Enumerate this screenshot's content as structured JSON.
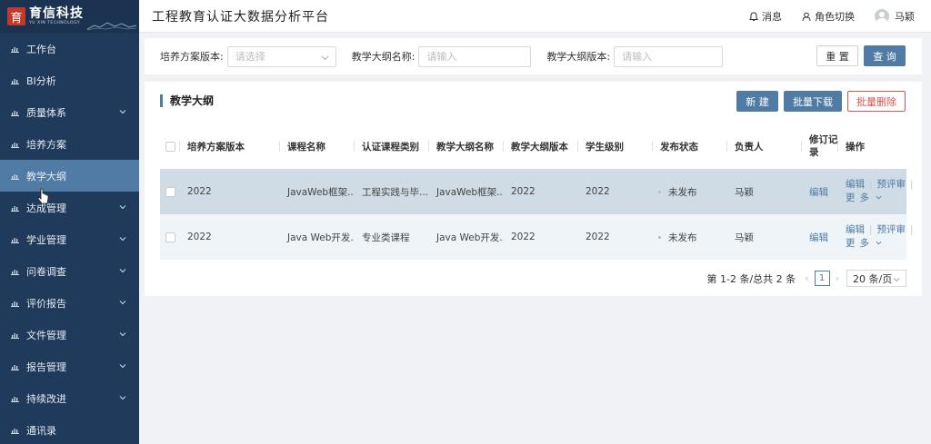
{
  "logo": {
    "mark": "育",
    "name": "育信科技",
    "sub": "YU XIN TECHNOLOGY"
  },
  "header": {
    "title": "工程教育认证大数据分析平台",
    "messages": "消息",
    "role_switch": "角色切换",
    "user": "马颖"
  },
  "sidebar": {
    "items": [
      {
        "label": "工作台",
        "expandable": false
      },
      {
        "label": "BI分析",
        "expandable": false
      },
      {
        "label": "质量体系",
        "expandable": true
      },
      {
        "label": "培养方案",
        "expandable": false
      },
      {
        "label": "教学大纲",
        "expandable": false,
        "active": true
      },
      {
        "label": "达成管理",
        "expandable": true
      },
      {
        "label": "学业管理",
        "expandable": true
      },
      {
        "label": "问卷调查",
        "expandable": true
      },
      {
        "label": "评价报告",
        "expandable": true
      },
      {
        "label": "文件管理",
        "expandable": true
      },
      {
        "label": "报告管理",
        "expandable": true
      },
      {
        "label": "持续改进",
        "expandable": true
      },
      {
        "label": "通讯录",
        "expandable": false
      }
    ]
  },
  "filter": {
    "plan_version_label": "培养方案版本:",
    "plan_version_placeholder": "请选择",
    "syllabus_name_label": "教学大纲名称:",
    "syllabus_name_placeholder": "请输入",
    "syllabus_version_label": "教学大纲版本:",
    "syllabus_version_placeholder": "请输入",
    "reset": "重 置",
    "query": "查 询"
  },
  "main": {
    "title": "教学大纲",
    "btn_new": "新 建",
    "btn_download": "批量下载",
    "btn_delete": "批量删除"
  },
  "table": {
    "headers": [
      "培养方案版本",
      "课程名称",
      "认证课程类别",
      "教学大纲名称",
      "教学大纲版本",
      "学生级别",
      "发布状态",
      "负责人",
      "修订记录",
      "操作"
    ],
    "rows": [
      {
        "plan": "2022",
        "course": "JavaWeb框架...",
        "category": "工程实践与毕...",
        "syllabus": "JavaWeb框架...",
        "version": "2022",
        "level": "2022",
        "status": "未发布",
        "owner": "马颖",
        "revision": "编辑",
        "op1": "编辑",
        "op2": "预评审",
        "op3": "更",
        "op4": "多"
      },
      {
        "plan": "2022",
        "course": "Java Web开发...",
        "category": "专业类课程",
        "syllabus": "Java Web开发...",
        "version": "2022",
        "level": "2022",
        "status": "未发布",
        "owner": "马颖",
        "revision": "编辑",
        "op1": "编辑",
        "op2": "预评审",
        "op3": "更",
        "op4": "多"
      }
    ]
  },
  "pager": {
    "summary": "第 1-2 条/总共 2 条",
    "page": "1",
    "size": "20 条/页"
  },
  "colors": {
    "sidebar": "#1f3a5a",
    "active": "#4f7ba5",
    "primary": "#4f7ba5",
    "danger": "#d9534f"
  }
}
